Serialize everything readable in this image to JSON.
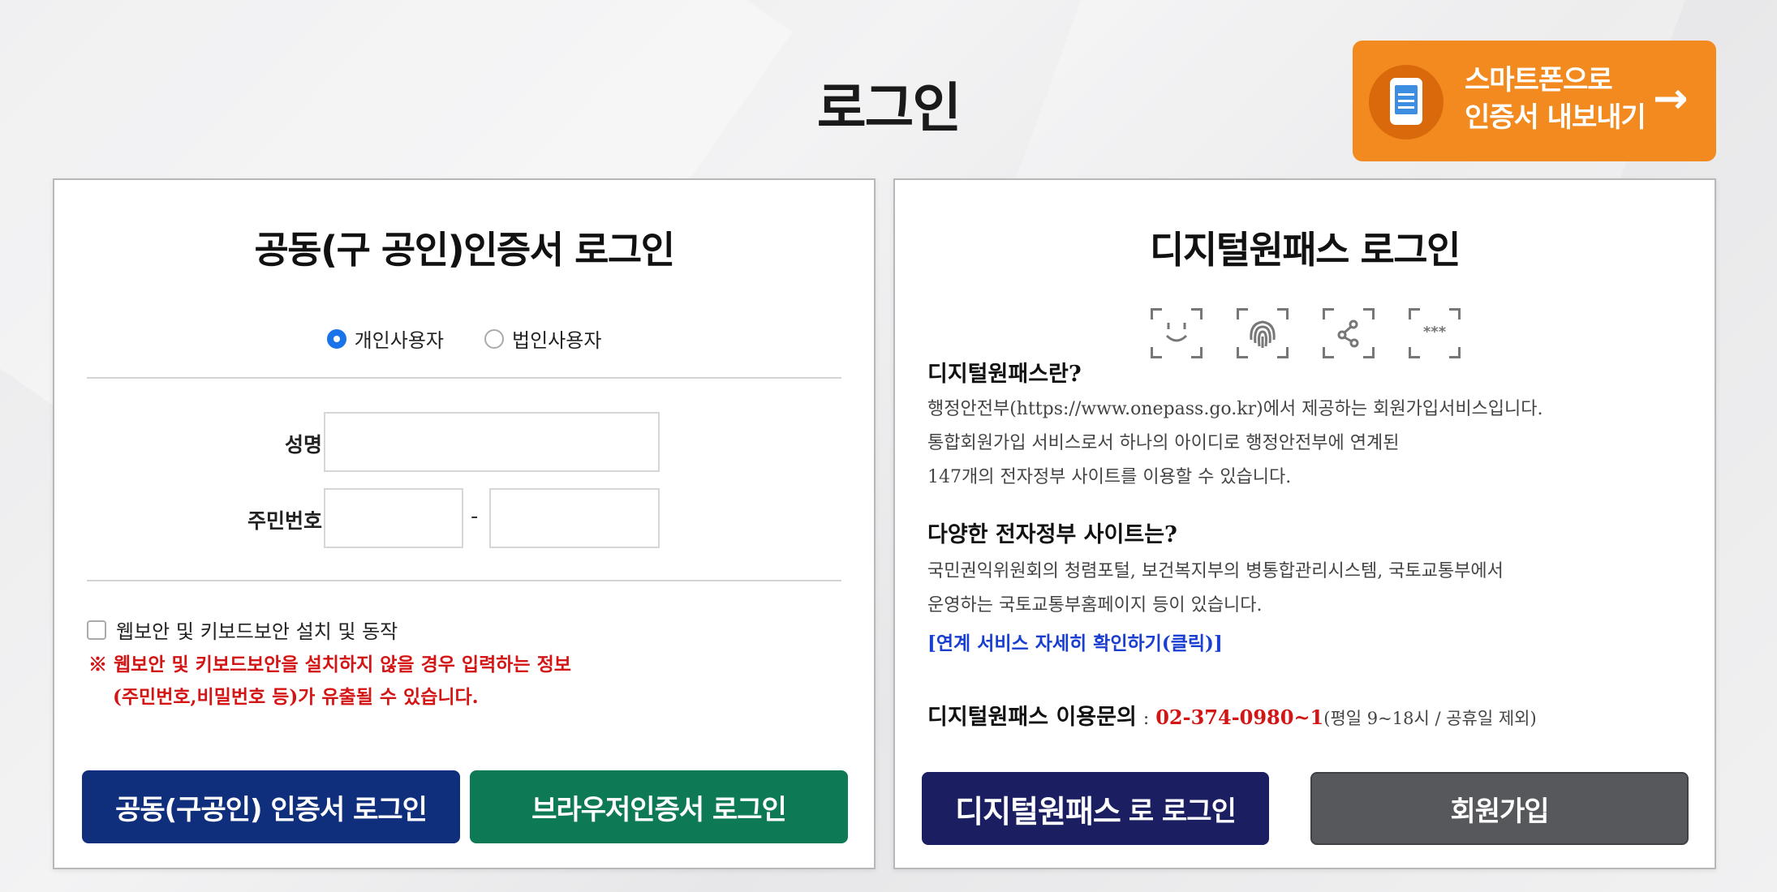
{
  "page_title": "로그인",
  "smart_button": {
    "line1": "스마트폰으로",
    "line2": "인증서 내보내기",
    "arrow": "→",
    "icon": "smartphone-icon",
    "color": "#f28a1f"
  },
  "cert_panel": {
    "title": "공동(구 공인)인증서 로그인",
    "radio_personal": "개인사용자",
    "radio_corporate": "법인사용자",
    "selected": "개인사용자",
    "name_label": "성명",
    "rrn_label": "주민번호",
    "rrn_dash": "-",
    "security_checkbox": "웹보안 및 키보드보안 설치 및 동작",
    "warning_line1": "※ 웹보안 및 키보드보안을 설치하지 않을 경우 입력하는 정보",
    "warning_line2": "(주민번호,비밀번호 등)가 유출될 수 있습니다.",
    "btn_cert_login": "공동(구공인) 인증서 로그인",
    "btn_browser_login": "브라우저인증서 로그인"
  },
  "onepass_panel": {
    "title": "디지털원패스 로그인",
    "bio_icons": [
      "face-scan-icon",
      "fingerprint-scan-icon",
      "pattern-scan-icon",
      "pin-scan-icon"
    ],
    "what_heading": "디지털원패스란?",
    "what_line1": "행정안전부(https://www.onepass.go.kr)에서 제공하는 회원가입서비스입니다.",
    "what_line2": "통합회원가입 서비스로서 하나의 아이디로 행정안전부에 연계된",
    "what_line3": "147개의 전자정부 사이트를 이용할 수 있습니다.",
    "sites_heading": "다양한 전자정부 사이트는?",
    "sites_line1": "국민권익위원회의 청렴포털, 보건복지부의 병통합관리시스템, 국토교통부에서",
    "sites_line2": "운영하는 국토교통부홈페이지 등이 있습니다.",
    "sites_link": "[연계 서비스 자세히 확인하기(클릭)]",
    "contact_label": "디지털원패스 이용문의",
    "contact_sep": ":",
    "contact_phone": "02-374-0980~1",
    "contact_hours": "(평일 9~18시 / 공휴일 제외)",
    "btn_onepass_big": "디지털원패스",
    "btn_onepass_rest": "로 로그인",
    "btn_signup": "회원가입"
  }
}
